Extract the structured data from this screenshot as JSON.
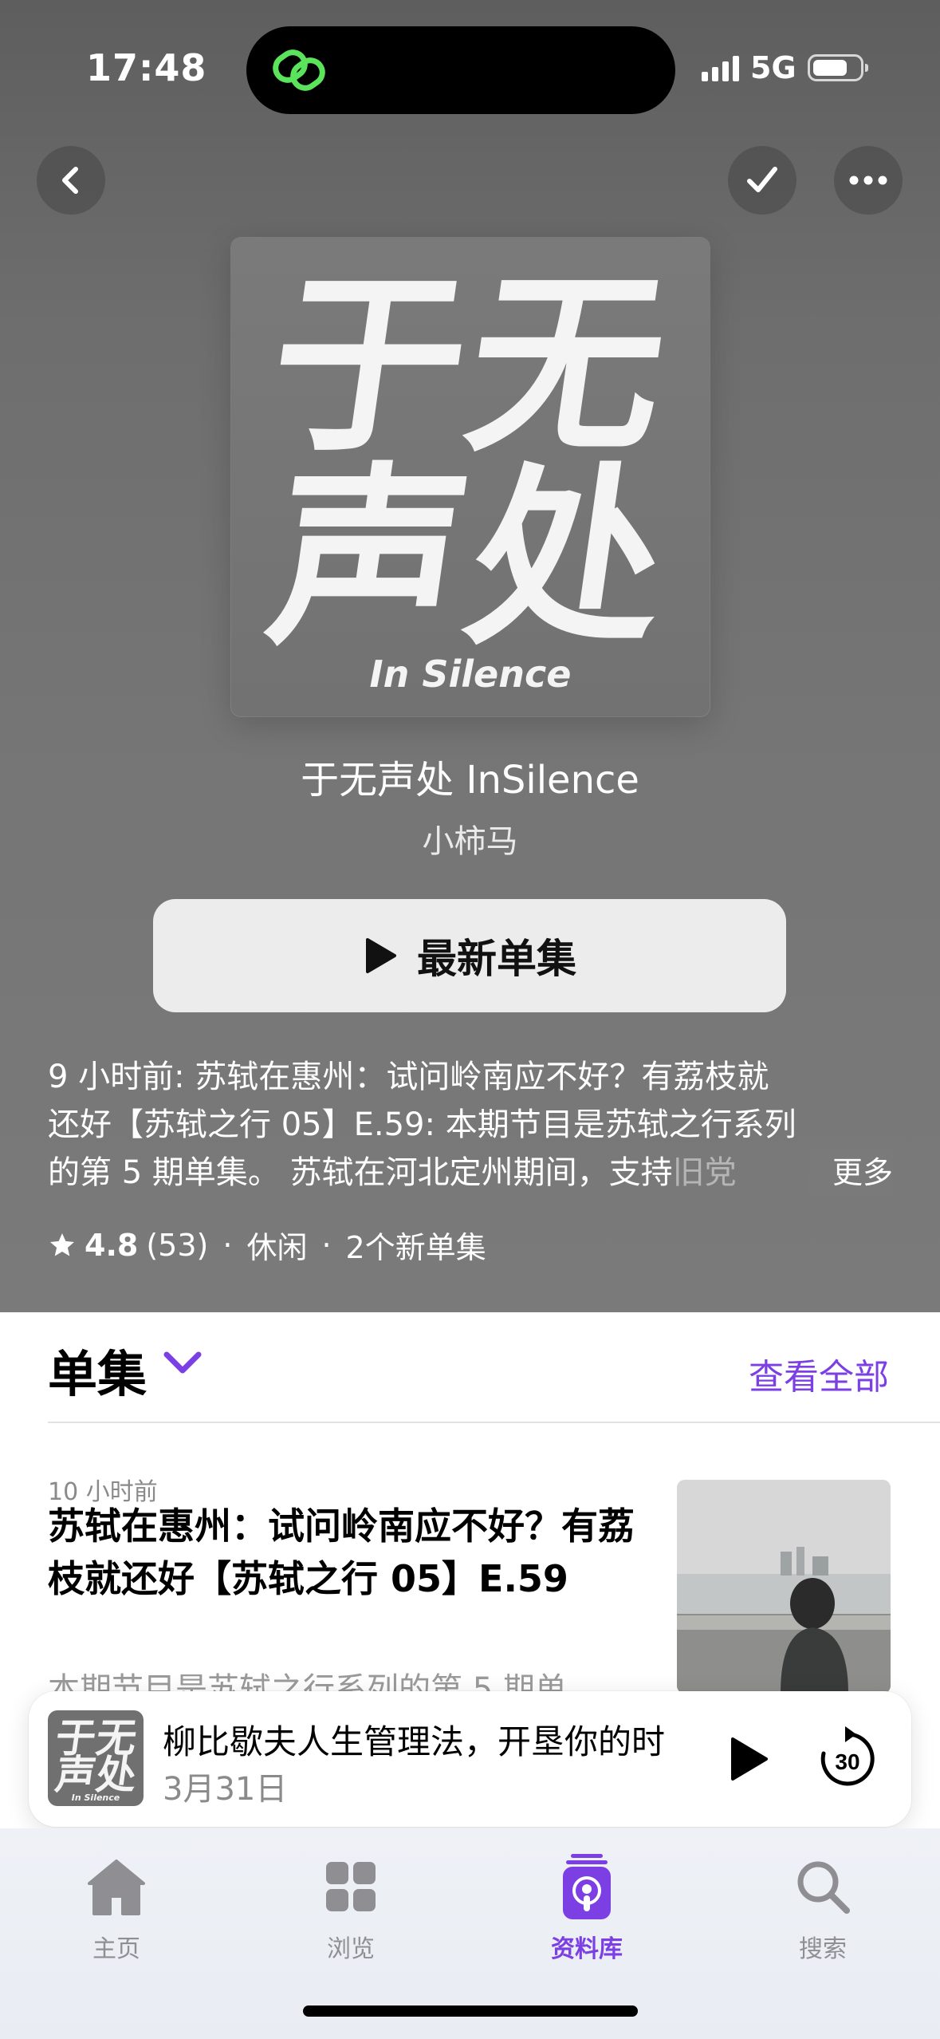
{
  "status_bar": {
    "time": "17:48",
    "network": "5G"
  },
  "nav": {
    "back_icon": "chevron-left-icon",
    "check_icon": "checkmark-icon",
    "more_icon": "ellipsis-icon"
  },
  "artwork": {
    "line1": "于无",
    "line2": "声处",
    "subtitle": "In Silence"
  },
  "show": {
    "title": "于无声处 InSilence",
    "author": "小柿马"
  },
  "play_button": {
    "label": "最新单集"
  },
  "description": {
    "line1": "9 小时前: 苏轼在惠州：试问岭南应不好？有荔枝就",
    "line2": "还好【苏轼之行 05】E.59: 本期节目是苏轼之行系列",
    "line3": "的第 5 期单集。 苏轼在河北定州期间，支持",
    "line3_fade": "旧党",
    "more": "更多"
  },
  "meta": {
    "rating": "4.8",
    "count": "(53)",
    "category": "休闲",
    "new_episodes": "2个新单集"
  },
  "episodes_section": {
    "title": "单集",
    "see_all": "查看全部"
  },
  "episode": {
    "time": "10 小时前",
    "title": "苏轼在惠州：试问岭南应不好？有荔枝就还好【苏轼之行 05】E.59",
    "description": "本期节目是苏轼之行系列的第 5 期单"
  },
  "mini_player": {
    "title": "柳比歇夫人生管理法，开垦你的时",
    "date": "3月31日",
    "skip_label": "30"
  },
  "tabs": [
    {
      "label": "主页",
      "icon": "house-icon",
      "active": false
    },
    {
      "label": "浏览",
      "icon": "grid-icon",
      "active": false
    },
    {
      "label": "资料库",
      "icon": "library-podcast-icon",
      "active": true
    },
    {
      "label": "搜索",
      "icon": "magnifier-icon",
      "active": false
    }
  ],
  "colors": {
    "accent": "#7b3fe4",
    "hero_bg": "#757575",
    "island_icon": "#5be35b"
  }
}
